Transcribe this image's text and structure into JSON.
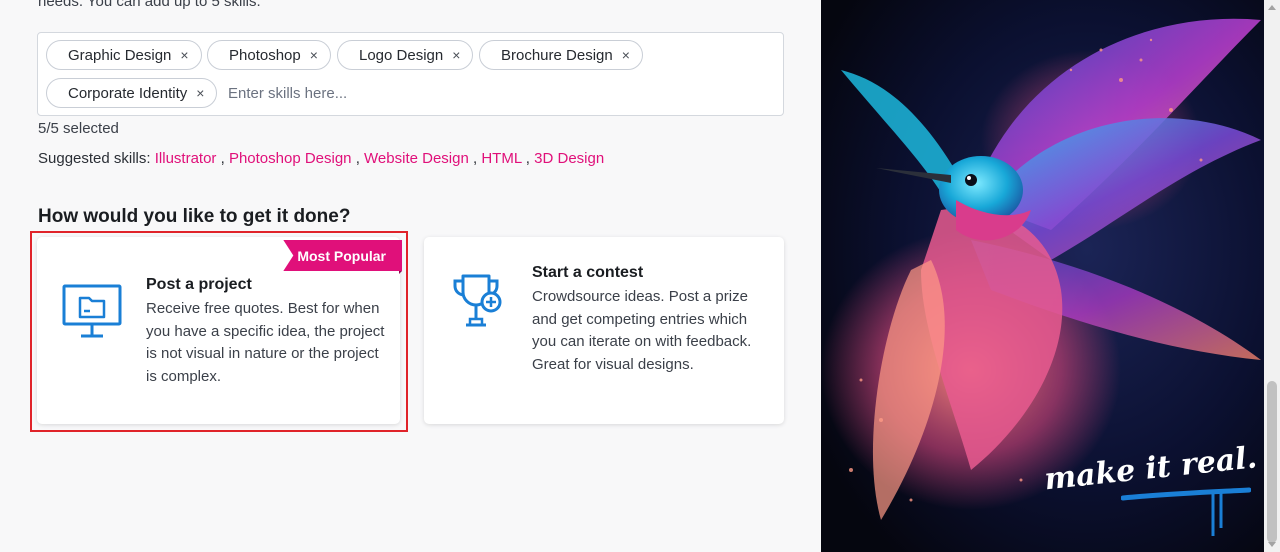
{
  "intro_text": "needs. You can add up to 5 skills.",
  "skills": {
    "chips": [
      {
        "label": "Graphic Design",
        "remove": "×"
      },
      {
        "label": "Photoshop",
        "remove": "×"
      },
      {
        "label": "Logo Design",
        "remove": "×"
      },
      {
        "label": "Brochure Design",
        "remove": "×"
      },
      {
        "label": "Corporate Identity",
        "remove": "×"
      }
    ],
    "input_placeholder": "Enter skills here...",
    "count_text": "5/5 selected"
  },
  "suggested": {
    "label": "Suggested skills:",
    "items": [
      "Illustrator",
      "Photoshop Design",
      "Website Design",
      "HTML",
      "3D Design"
    ],
    "separator": ","
  },
  "question": "How would you like to get it done?",
  "options": [
    {
      "title": "Post a project",
      "description": "Receive free quotes. Best for when you have a specific idea, the project is not visual in nature or the project is complex.",
      "badge": "Most Popular",
      "icon": "monitor-folder-icon",
      "selected": true
    },
    {
      "title": "Start a contest",
      "description": "Crowdsource ideas. Post a prize and get competing entries which you can iterate on with feedback. Great for visual designs.",
      "icon": "trophy-plus-icon",
      "selected": false
    }
  ],
  "art": {
    "tagline": "make it real."
  },
  "colors": {
    "accent": "#e0107a",
    "icon_blue": "#1a7fd6",
    "selection_outline": "#e0232a"
  }
}
